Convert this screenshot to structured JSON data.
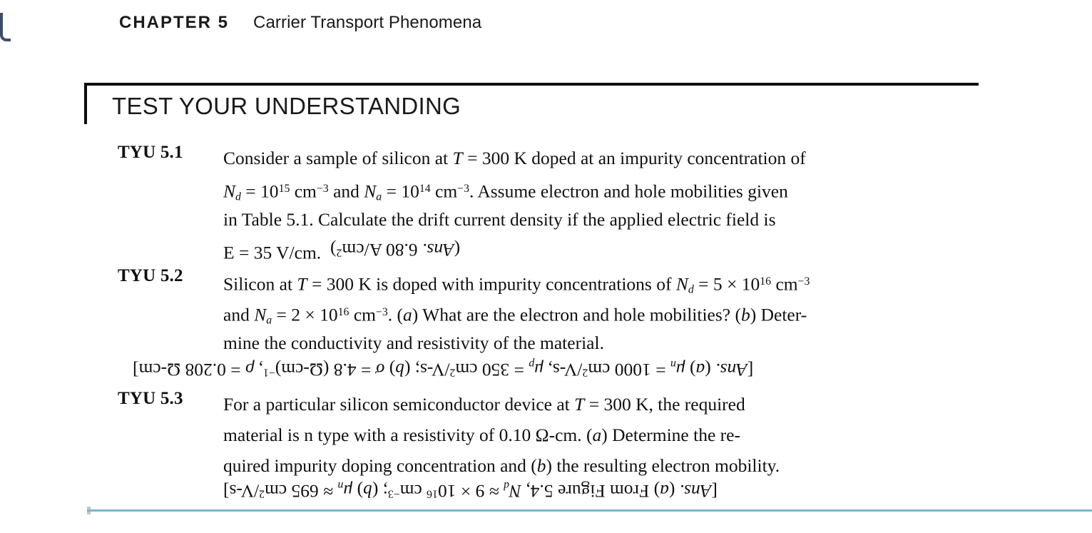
{
  "running_head": {
    "chapter_label": "CHAPTER 5",
    "chapter_title": "Carrier Transport Phenomena"
  },
  "section": {
    "heading": "TEST YOUR UNDERSTANDING"
  },
  "exercises": [
    {
      "label": "TYU 5.1",
      "lines": [
        "Consider a sample of silicon at T = 300 K doped at an impurity concentration of",
        "Nd = 10^15 cm^-3 and Na = 10^14 cm^-3. Assume electron and hole mobilities given",
        "in Table 5.1. Calculate the drift current density if the applied electric field is",
        "E = 35 V/cm."
      ],
      "answer": "(Ans. 6.80 A/cm²)",
      "answer_orientation": "upside-down",
      "answer_placement": "inline-after-last-line"
    },
    {
      "label": "TYU 5.2",
      "lines": [
        "Silicon at T = 300 K is doped with impurity concentrations of Nd = 5 × 10^16 cm^-3",
        "and Na = 2 × 10^16 cm^-3. (a) What are the electron and hole mobilities? (b) Deter-",
        "mine the conductivity and resistivity of the material."
      ],
      "answer": "[Ans. (a) μn = 1000 cm²/V-s, μp = 350 cm²/V-s; (b) σ = 4.8 (Ω-cm)⁻¹, ρ = 0.208 Ω-cm]",
      "answer_orientation": "upside-down",
      "answer_placement": "own-line"
    },
    {
      "label": "TYU 5.3",
      "lines": [
        "For a particular silicon semiconductor device at T = 300 K, the required",
        "material is n type with a resistivity of 0.10 Ω-cm. (a) Determine the re-",
        "quired impurity doping concentration and (b) the resulting electron mobility."
      ],
      "answer": "[Ans. (a) From Figure 5.4, Nd ≈ 9 × 10¹⁶ cm⁻³; (b) μn ≈ 695 cm²/V-s]",
      "answer_orientation": "upside-down",
      "answer_placement": "own-line"
    }
  ],
  "colors": {
    "text": "#101010",
    "rule": "#0d0d0d",
    "bottom_rule": "#7fb4cc",
    "page_edge": "#2c3e60"
  }
}
